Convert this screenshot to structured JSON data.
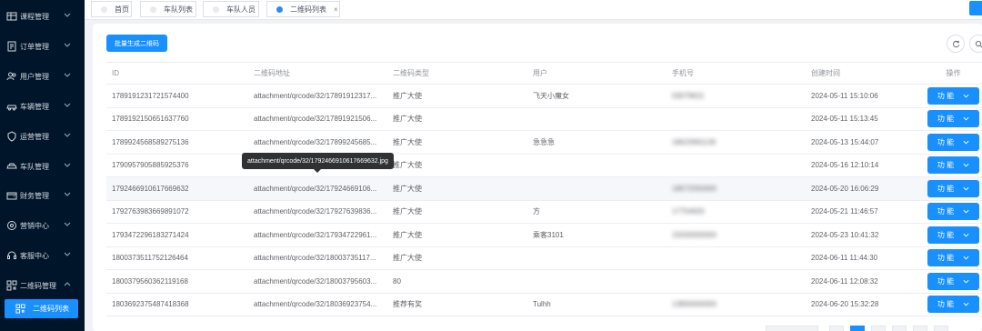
{
  "sidebar": {
    "items": [
      {
        "label": "课程管理",
        "icon": "table-icon"
      },
      {
        "label": "订单管理",
        "icon": "order-icon"
      },
      {
        "label": "用户管理",
        "icon": "users-icon"
      },
      {
        "label": "车辆管理",
        "icon": "car-icon"
      },
      {
        "label": "运营管理",
        "icon": "shield-icon"
      },
      {
        "label": "车队管理",
        "icon": "fleet-icon"
      },
      {
        "label": "财务管理",
        "icon": "wallet-icon"
      },
      {
        "label": "营销中心",
        "icon": "marketing-icon"
      },
      {
        "label": "客服中心",
        "icon": "service-icon"
      },
      {
        "label": "二维码管理",
        "icon": "qrcode-icon"
      }
    ],
    "active_item": {
      "label": "二维码列表",
      "icon": "qrcode-icon"
    }
  },
  "tabs": [
    {
      "label": "首页"
    },
    {
      "label": "车队列表"
    },
    {
      "label": "车队人员"
    },
    {
      "label": "二维码列表",
      "close": "×"
    }
  ],
  "toolbar": {
    "generate_label": "批量生成二维码"
  },
  "table": {
    "headers": {
      "id": "ID",
      "address": "二维码地址",
      "type": "二维码类型",
      "user": "用户",
      "phone": "手机号",
      "created": "创建时间",
      "op": "操作"
    },
    "rows": [
      {
        "id": "1789191231721574400",
        "address": "attachment/qrcode/32/17891912317...",
        "type": "推广大使",
        "user": "飞天小魔女",
        "phone": "03079621",
        "created": "2024-05-11 15:10:06"
      },
      {
        "id": "1789192150651637760",
        "address": "attachment/qrcode/32/17891921506...",
        "type": "推广大使",
        "user": "",
        "phone": "",
        "created": "2024-05-11 15:13:45"
      },
      {
        "id": "1789924568589275136",
        "address": "attachment/qrcode/32/17899245685...",
        "type": "推广大使",
        "user": "急急急",
        "phone": "18623991130",
        "created": "2024-05-13 15:44:07"
      },
      {
        "id": "1790957905885925376",
        "address": "attachment/qrcode/32/17909579058...",
        "type": "推广大使",
        "user": "",
        "phone": "",
        "created": "2024-05-16 12:10:14"
      },
      {
        "id": "1792466910617669632",
        "address": "attachment/qrcode/32/17924669106...",
        "type": "推广大使",
        "user": "",
        "phone": "18672050000",
        "created": "2024-05-20 16:06:29"
      },
      {
        "id": "1792763983669891072",
        "address": "attachment/qrcode/32/17927639836...",
        "type": "推广大使",
        "user": "方",
        "phone": "17754920",
        "created": "2024-05-21 11:46:57"
      },
      {
        "id": "1793472296183271424",
        "address": "attachment/qrcode/32/17934722961...",
        "type": "推广大使",
        "user": "乘客3101",
        "phone": "15500000000",
        "created": "2024-05-23 10:41:32"
      },
      {
        "id": "1800373511752126464",
        "address": "attachment/qrcode/32/18003735117...",
        "type": "推广大使",
        "user": "",
        "phone": "",
        "created": "2024-06-11 11:44:30"
      },
      {
        "id": "1800379560362119168",
        "address": "attachment/qrcode/32/18003795603...",
        "type": "80",
        "user": "",
        "phone": "",
        "created": "2024-06-11 12:08:32"
      },
      {
        "id": "1803692375487418368",
        "address": "attachment/qrcode/32/18036923754...",
        "type": "推荐有奖",
        "user": "Tulhh",
        "phone": "13800000000",
        "created": "2024-06-20 15:32:28"
      }
    ],
    "op_label": "功 能"
  },
  "tooltip": {
    "text": "attachment/qrcode/32/1792466910617669632.jpg"
  },
  "colors": {
    "primary": "#1890ff",
    "sidebar": "#001529"
  }
}
